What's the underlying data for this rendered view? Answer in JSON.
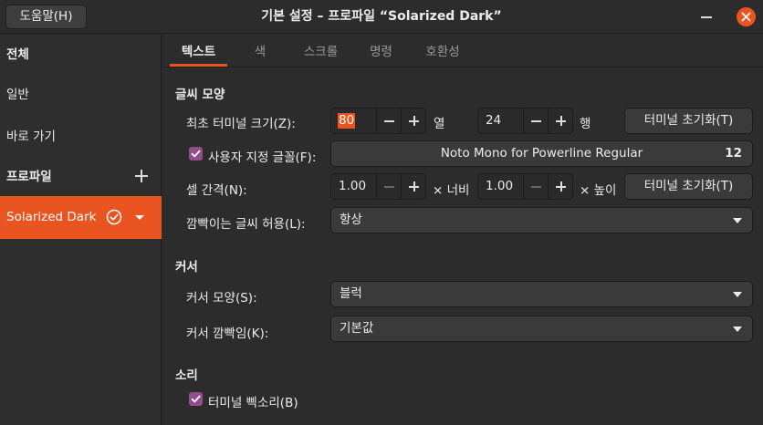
{
  "titlebar": {
    "help_label": "도움말(H)",
    "title": "기본 설정 – 프로파일 “Solarized Dark”"
  },
  "sidebar": {
    "all_label": "전체",
    "general_label": "일반",
    "shortcuts_label": "바로 가기",
    "profiles_label": "프로파일",
    "selected_profile": "Solarized Dark"
  },
  "tabs": [
    "텍스트",
    "색",
    "스크롤",
    "명령",
    "호환성"
  ],
  "text_tab": {
    "appearance_title": "글씨 모양",
    "initial_size_label": "최초 터미널 크기(Z):",
    "columns_value": "80",
    "columns_unit": "열",
    "rows_value": "24",
    "rows_unit": "행",
    "reset_label_1": "터미널 초기화(T)",
    "custom_font_label": "사용자 지정 글꼴(F):",
    "custom_font_checked": true,
    "font_name": "Noto Mono for Powerline Regular",
    "font_size": "12",
    "cell_spacing_label": "셀 간격(N):",
    "width_value": "1.00",
    "width_unit": "× 너비",
    "height_value": "1.00",
    "height_unit": "× 높이",
    "reset_label_2": "터미널 초기화(T)",
    "blink_label": "깜빡이는 글씨 허용(L):",
    "blink_value": "항상",
    "cursor_title": "커서",
    "cursor_shape_label": "커서 모양(S):",
    "cursor_shape_value": "블럭",
    "cursor_blink_label": "커서 깜빡임(K):",
    "cursor_blink_value": "기본값",
    "sound_title": "소리",
    "bell_label": "터미널 삑소리(B)",
    "bell_checked": true
  },
  "colors": {
    "accent": "#e95420",
    "checkbox": "#924d8b",
    "background": "#2c2c2c"
  }
}
